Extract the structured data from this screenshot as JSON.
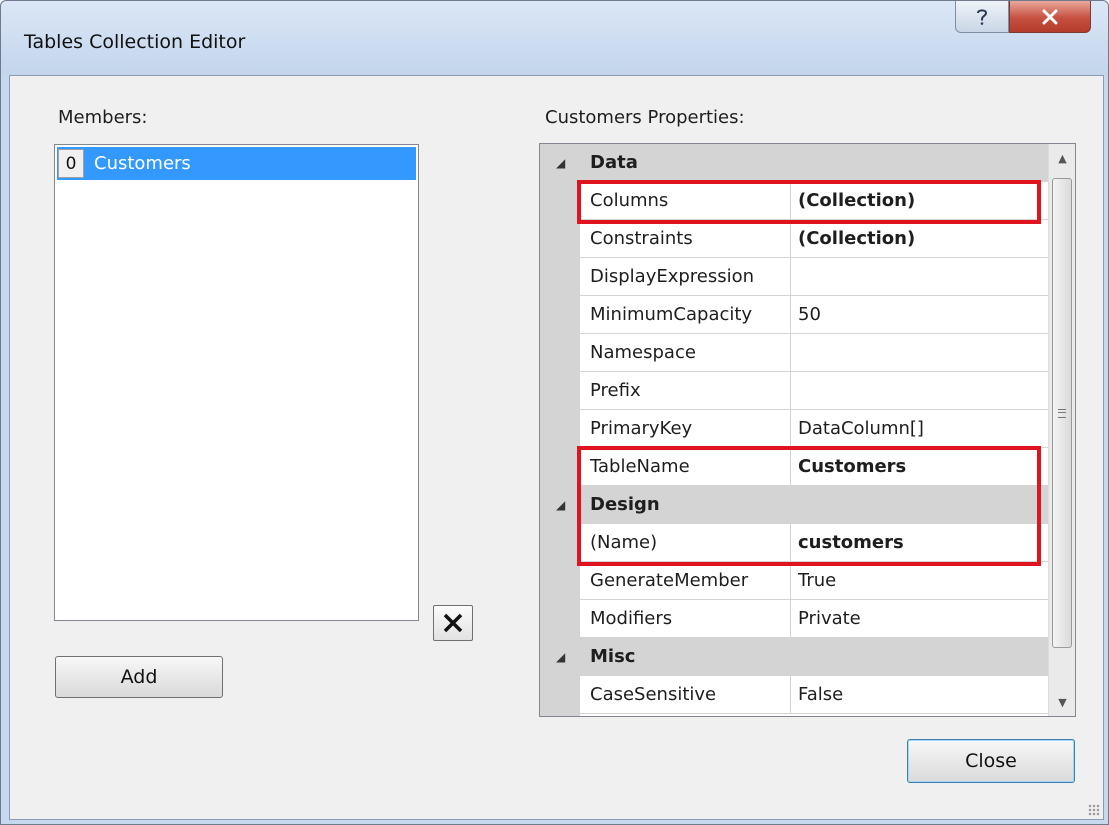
{
  "window": {
    "title": "Tables Collection Editor",
    "help_icon": "question-mark-icon",
    "close_icon": "close-x-icon"
  },
  "members": {
    "label": "Members:",
    "items": [
      {
        "index": "0",
        "name": "Customers",
        "selected": true
      }
    ],
    "add_label": "Add",
    "delete_icon": "delete-x-icon"
  },
  "properties": {
    "label": "Customers Properties:",
    "categories": [
      {
        "name": "Data",
        "rows": [
          {
            "name": "Columns",
            "value": "(Collection)",
            "bold": true
          },
          {
            "name": "Constraints",
            "value": "(Collection)",
            "bold": true
          },
          {
            "name": "DisplayExpression",
            "value": "",
            "bold": false
          },
          {
            "name": "MinimumCapacity",
            "value": "50",
            "bold": false
          },
          {
            "name": "Namespace",
            "value": "",
            "bold": false
          },
          {
            "name": "Prefix",
            "value": "",
            "bold": false
          },
          {
            "name": "PrimaryKey",
            "value": "DataColumn[]",
            "bold": false
          },
          {
            "name": "TableName",
            "value": "Customers",
            "bold": true
          }
        ]
      },
      {
        "name": "Design",
        "rows": [
          {
            "name": "(Name)",
            "value": "customers",
            "bold": true
          },
          {
            "name": "GenerateMember",
            "value": "True",
            "bold": false
          },
          {
            "name": "Modifiers",
            "value": "Private",
            "bold": false
          }
        ]
      },
      {
        "name": "Misc",
        "rows": [
          {
            "name": "CaseSensitive",
            "value": "False",
            "bold": false
          }
        ]
      }
    ],
    "highlight_color": "#e0141e"
  },
  "footer": {
    "close_label": "Close"
  }
}
